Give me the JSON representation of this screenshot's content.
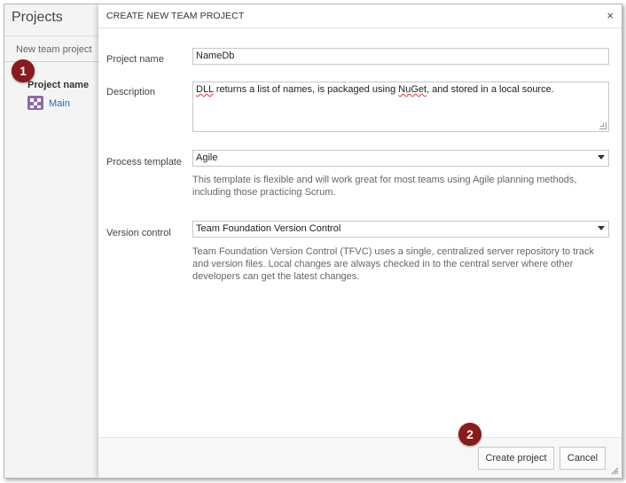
{
  "background": {
    "title": "Projects",
    "new_team_project": "New team project",
    "column_header": "Project name",
    "projects": [
      {
        "name": "Main"
      }
    ]
  },
  "callouts": {
    "first": "1",
    "second": "2"
  },
  "dialog": {
    "title": "CREATE NEW TEAM PROJECT",
    "close_icon": "×",
    "project_name": {
      "label": "Project name",
      "value": "NameDb"
    },
    "description": {
      "label": "Description",
      "value_parts": [
        "DLL",
        " returns a list of names, is packaged using ",
        "NuGet",
        ", and stored in a local source."
      ]
    },
    "process_template": {
      "label": "Process template",
      "value": "Agile",
      "help": "This template is flexible and will work great for most teams using Agile planning methods, including those practicing Scrum."
    },
    "version_control": {
      "label": "Version control",
      "value": "Team Foundation Version Control",
      "help": "Team Foundation Version Control (TFVC) uses a single, centralized server repository to track and version files. Local changes are always checked in to the central server where other developers can get the latest changes."
    },
    "buttons": {
      "create": "Create project",
      "cancel": "Cancel"
    }
  },
  "colors": {
    "callout": "#8b1a1a",
    "link": "#2a6cb5",
    "project_icon": "#8d6aa8"
  }
}
